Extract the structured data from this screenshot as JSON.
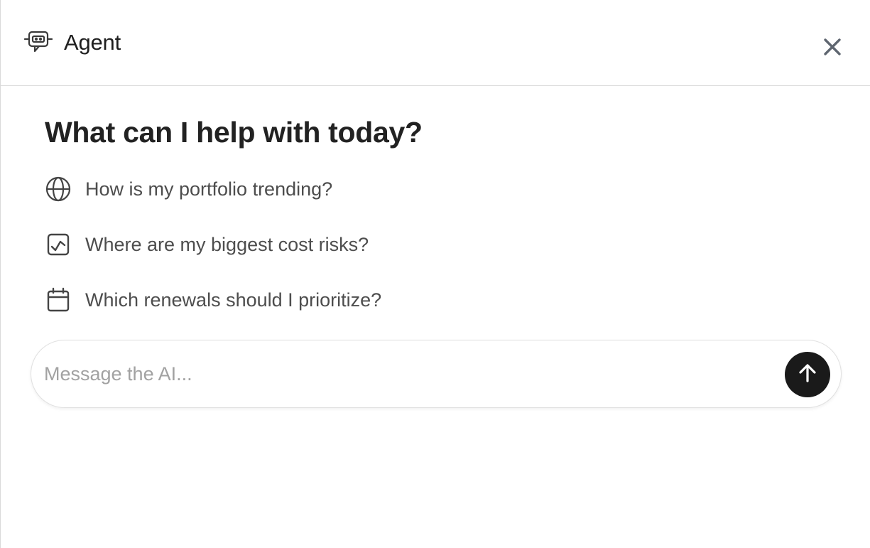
{
  "header": {
    "title": "Agent",
    "icon": "robot-chat-icon",
    "close_icon": "close-icon"
  },
  "main": {
    "heading": "What can I help with today?",
    "suggestions": [
      {
        "label": "How is my portfolio trending?",
        "icon": "globe-icon"
      },
      {
        "label": "Where are my biggest cost risks?",
        "icon": "chart-activity-icon"
      },
      {
        "label": "Which renewals should I prioritize?",
        "icon": "calendar-icon"
      }
    ]
  },
  "composer": {
    "placeholder": "Message the AI...",
    "value": "",
    "send_icon": "arrow-up-icon"
  },
  "colors": {
    "send_button": "#1a1a1a",
    "text_primary": "#222222",
    "text_secondary": "#4d4d4d",
    "placeholder": "#a2a2a2",
    "border": "#dcdcdc"
  }
}
